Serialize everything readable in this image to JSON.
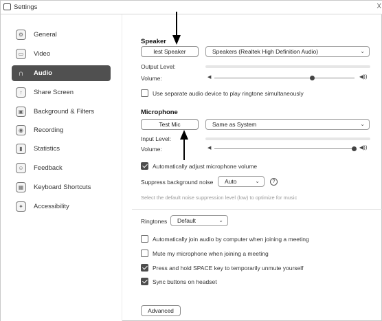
{
  "window": {
    "title": "Settings",
    "close": "X"
  },
  "sidebar": {
    "items": [
      {
        "label": "General",
        "icon": "gear-icon",
        "glyph": "⚙"
      },
      {
        "label": "Video",
        "icon": "video-icon",
        "glyph": "▭"
      },
      {
        "label": "Audio",
        "icon": "headphones-icon",
        "glyph": "∩"
      },
      {
        "label": "Share Screen",
        "icon": "share-screen-icon",
        "glyph": "↑"
      },
      {
        "label": "Background & Filters",
        "icon": "background-icon",
        "glyph": "▣"
      },
      {
        "label": "Recording",
        "icon": "recording-icon",
        "glyph": "◉"
      },
      {
        "label": "Statistics",
        "icon": "statistics-icon",
        "glyph": "▮"
      },
      {
        "label": "Feedback",
        "icon": "feedback-icon",
        "glyph": "☺"
      },
      {
        "label": "Keyboard Shortcuts",
        "icon": "keyboard-icon",
        "glyph": "▦"
      },
      {
        "label": "Accessibility",
        "icon": "accessibility-icon",
        "glyph": "✦"
      }
    ],
    "active_index": 2
  },
  "speaker": {
    "heading": "Speaker",
    "test_button": "lest Speaker",
    "device": "Speakers (Realtek High Definition Audio)",
    "output_level_label": "Output Level:",
    "volume_label": "Volume:",
    "volume_value": 0.7,
    "separate_device_label": "Use separate audio device to play ringtone simultaneously",
    "separate_device_checked": false
  },
  "microphone": {
    "heading": "Microphone",
    "test_button": "Test Mic",
    "device": "Same as System",
    "input_level_label": "Input Level:",
    "volume_label": "Volume:",
    "volume_value": 1.0,
    "auto_adjust_label": "Automatically adjust microphone volume",
    "auto_adjust_checked": true,
    "noise_label": "Suppress background noise",
    "noise_value": "Auto",
    "noise_hint": "Select the default noise suppression level (low) to optimize for music"
  },
  "ringtones": {
    "label": "Ringtones",
    "value": "Default"
  },
  "options": [
    {
      "label": "Automatically join audio by computer when joining a meeting",
      "checked": false
    },
    {
      "label": "Mute my microphone when joining a meeting",
      "checked": false
    },
    {
      "label": "Press and hold SPACE key to temporarily unmute yourself",
      "checked": true
    },
    {
      "label": "Sync buttons on headset",
      "checked": true
    }
  ],
  "advanced_button": "Advanced",
  "colors": {
    "active_nav": "#505050",
    "checkbox_checked": "#4d4d4d"
  }
}
